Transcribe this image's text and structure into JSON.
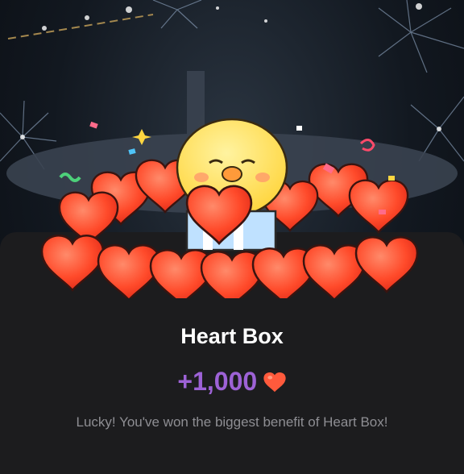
{
  "reward": {
    "title": "Heart Box",
    "amount": "+1,000",
    "message": "Lucky! You've won the biggest benefit of Heart Box!",
    "currency_icon": "heart-icon"
  },
  "colors": {
    "amount": "#9d62d6",
    "heart": "#ff5a3c",
    "card": "#1c1c1e"
  }
}
